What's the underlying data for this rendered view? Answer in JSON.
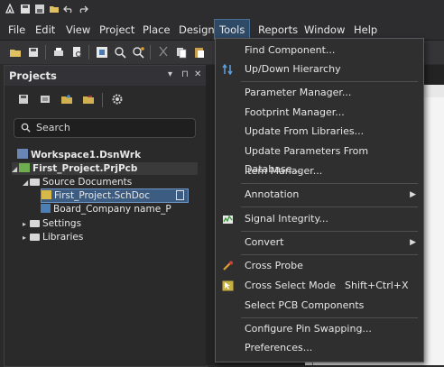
{
  "menubar": {
    "items": [
      "File",
      "Edit",
      "View",
      "Project",
      "Place",
      "Design",
      "Tools",
      "Reports",
      "Window",
      "Help"
    ]
  },
  "projects_panel": {
    "title": "Projects",
    "search_placeholder": "Search",
    "tree": {
      "workspace": "Workspace1.DsnWrk",
      "project": "First_Project.PrjPcb",
      "source_documents": "Source Documents",
      "schdoc": "First_Project.SchDoc",
      "board": "Board_Company name_P",
      "settings": "Settings",
      "libraries": "Libraries"
    }
  },
  "tools_menu": {
    "find_component": "Find Component...",
    "updown_hierarchy": "Up/Down Hierarchy",
    "parameter_manager": "Parameter Manager...",
    "footprint_manager": "Footprint Manager...",
    "update_from_libraries": "Update From Libraries...",
    "update_parameters_from_database": "Update Parameters From Database...",
    "item_manager": "Item Manager...",
    "annotation": "Annotation",
    "signal_integrity": "Signal Integrity...",
    "convert": "Convert",
    "cross_probe": "Cross Probe",
    "cross_select_mode": "Cross Select Mode",
    "cross_select_shortcut": "Shift+Ctrl+X",
    "select_pcb_components": "Select PCB Components",
    "configure_pin_swapping": "Configure Pin Swapping...",
    "preferences": "Preferences..."
  },
  "colors": {
    "menu_active": "#2f4a66",
    "selection": "#3d5c82",
    "background": "#2b2b2b"
  }
}
